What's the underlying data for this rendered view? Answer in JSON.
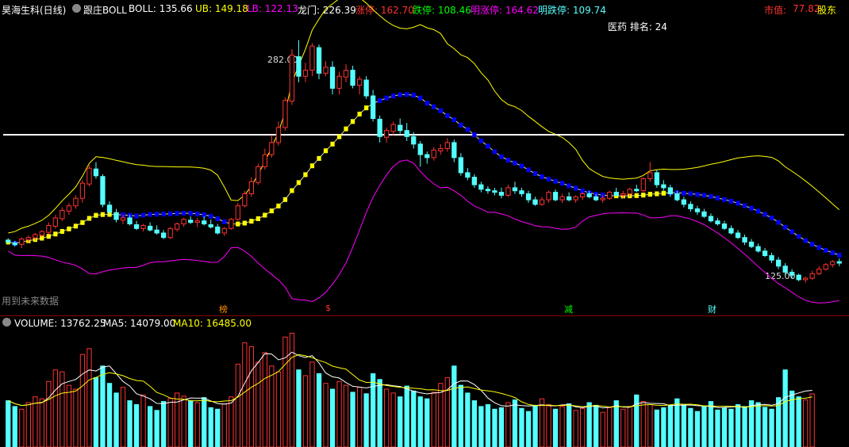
{
  "header": {
    "title": "昊海生科(日线)",
    "indicator": "跟庄BOLL",
    "boll": "BOLL: 135.66",
    "ub": "UB: 149.18",
    "lb": "LB: 122.13",
    "longmen": "龙门: 226.39",
    "zt": "涨停: 162.70",
    "dt": "跌停: 108.46",
    "mzt": "明涨停: 164.62",
    "mdt": "明跌停: 109.74",
    "mktcap_label": "市值:",
    "mktcap_value": "77.82",
    "holders": "股东",
    "rank": "医药 排名: 24",
    "future_note": "用到未来数据",
    "high_label": "282.00",
    "low_label": "125.00"
  },
  "markers": [
    "榜",
    "$",
    "减",
    "财"
  ],
  "volume_header": {
    "volume": "VOLUME: 13762.25",
    "ma5": "MA5: 14079.00",
    "ma10": "MA10: 16485.00"
  },
  "colors": {
    "up": "#ff3232",
    "down": "#54ffff",
    "ub": "#ffff00",
    "lb": "#ff00ff",
    "mid": "#ffffff",
    "buy": "#ffff00",
    "sell": "#0000ff"
  },
  "chart_data": {
    "type": "candlestick",
    "price_range": [
      118,
      300
    ],
    "volume_range": [
      0,
      30000
    ],
    "candles": [
      [
        153.2,
        154.5,
        150.8,
        152
      ],
      [
        151.5,
        152.8,
        149,
        150.2
      ],
      [
        150.5,
        155,
        148,
        154
      ],
      [
        153.5,
        156.5,
        151.5,
        155
      ],
      [
        154.8,
        158,
        153,
        157
      ],
      [
        156.5,
        160,
        155.5,
        159
      ],
      [
        158.5,
        165,
        157,
        163
      ],
      [
        162.5,
        170,
        161,
        168
      ],
      [
        167.5,
        175,
        166,
        173
      ],
      [
        172.5,
        178,
        170,
        176
      ],
      [
        176,
        183,
        174,
        181
      ],
      [
        181,
        193,
        178,
        191
      ],
      [
        190.5,
        203,
        189,
        201
      ],
      [
        200.5,
        205,
        194,
        196
      ],
      [
        195.5,
        197,
        175,
        177
      ],
      [
        176.5,
        179,
        170,
        172
      ],
      [
        171.5,
        174,
        165,
        167
      ],
      [
        166.5,
        170,
        164,
        168
      ],
      [
        168,
        170,
        163,
        164
      ],
      [
        163.5,
        166,
        160,
        161
      ],
      [
        161,
        164,
        159,
        163
      ],
      [
        162.5,
        165,
        159,
        160
      ],
      [
        160,
        163,
        157,
        158
      ],
      [
        158,
        160,
        154,
        155
      ],
      [
        155,
        162,
        154,
        161
      ],
      [
        160.5,
        165,
        159,
        164
      ],
      [
        164,
        168,
        162,
        167
      ],
      [
        166.5,
        169,
        164,
        165
      ],
      [
        165,
        168,
        162,
        166
      ],
      [
        166,
        169,
        163,
        164
      ],
      [
        163.5,
        167,
        161,
        162
      ],
      [
        162,
        164,
        157,
        158
      ],
      [
        158,
        162,
        156,
        161
      ],
      [
        161,
        168,
        160,
        167
      ],
      [
        167,
        178,
        166,
        176
      ],
      [
        176,
        186,
        175,
        184
      ],
      [
        184,
        195,
        182,
        192
      ],
      [
        191.5,
        204,
        190,
        202
      ],
      [
        202,
        214,
        200,
        210
      ],
      [
        210,
        223,
        208,
        218
      ],
      [
        218,
        232,
        216,
        228
      ],
      [
        228,
        248,
        226,
        246
      ],
      [
        245.5,
        280,
        243,
        276
      ],
      [
        275,
        286,
        258,
        262
      ],
      [
        262,
        271,
        258,
        266
      ],
      [
        266,
        284,
        262,
        282
      ],
      [
        281,
        283,
        260,
        264
      ],
      [
        264,
        272,
        262,
        268
      ],
      [
        268,
        272,
        250,
        254
      ],
      [
        254,
        265,
        250,
        262
      ],
      [
        261.5,
        270,
        258,
        266
      ],
      [
        266,
        269,
        254,
        256
      ],
      [
        256,
        262,
        250,
        260
      ],
      [
        259.5,
        262,
        247,
        249
      ],
      [
        249,
        253,
        232,
        234
      ],
      [
        233.5,
        236,
        218,
        222
      ],
      [
        221.5,
        228,
        218,
        226
      ],
      [
        225.5,
        232,
        223,
        230
      ],
      [
        229.5,
        234,
        224,
        226
      ],
      [
        226,
        231,
        219,
        222
      ],
      [
        222,
        225,
        214,
        217
      ],
      [
        217,
        219,
        202,
        210
      ],
      [
        210,
        212,
        204,
        208
      ],
      [
        208,
        215,
        206,
        213
      ],
      [
        212.5,
        217,
        210,
        214
      ],
      [
        214,
        221,
        212,
        218
      ],
      [
        218,
        220,
        205,
        208
      ],
      [
        208,
        211,
        196,
        198
      ],
      [
        198,
        201,
        193,
        195
      ],
      [
        195,
        197,
        188,
        190
      ],
      [
        190,
        192,
        185,
        187
      ],
      [
        187,
        189,
        184,
        186
      ],
      [
        186,
        188,
        183,
        185
      ],
      [
        185,
        188,
        181,
        183
      ],
      [
        183,
        190,
        182,
        188
      ],
      [
        188,
        192,
        184,
        186
      ],
      [
        186,
        188,
        182,
        184
      ],
      [
        184,
        186,
        178,
        180
      ],
      [
        180,
        182,
        176,
        177
      ],
      [
        177,
        182,
        176,
        180
      ],
      [
        180,
        186,
        178,
        185
      ],
      [
        185,
        187,
        179,
        180
      ],
      [
        180,
        184,
        178,
        182
      ],
      [
        182,
        185,
        179,
        180
      ],
      [
        180,
        183,
        178,
        182
      ],
      [
        182,
        185,
        180,
        184
      ],
      [
        184,
        186,
        181,
        182
      ],
      [
        182,
        184,
        179,
        180
      ],
      [
        180,
        183,
        178,
        181
      ],
      [
        181,
        186,
        180,
        185
      ],
      [
        185,
        188,
        182,
        183
      ],
      [
        183,
        186,
        181,
        184
      ],
      [
        184,
        188,
        182,
        187
      ],
      [
        187,
        190,
        185,
        186
      ],
      [
        186,
        195,
        185,
        194
      ],
      [
        194,
        205,
        192,
        198
      ],
      [
        198,
        200,
        188,
        190
      ],
      [
        190,
        193,
        186,
        188
      ],
      [
        188,
        190,
        182,
        184
      ],
      [
        184,
        186,
        179,
        180
      ],
      [
        180,
        182,
        175,
        177
      ],
      [
        177,
        179,
        172,
        174
      ],
      [
        174,
        176,
        170,
        172
      ],
      [
        172,
        174,
        168,
        169
      ],
      [
        169,
        171,
        165,
        166
      ],
      [
        166,
        168,
        163,
        164
      ],
      [
        164,
        166,
        160,
        161
      ],
      [
        161,
        163,
        157,
        158
      ],
      [
        158,
        160,
        154,
        155
      ],
      [
        155,
        157,
        150,
        152
      ],
      [
        152,
        154,
        148,
        149
      ],
      [
        149,
        151,
        145,
        146
      ],
      [
        146,
        148,
        142,
        143
      ],
      [
        143,
        145,
        138,
        140
      ],
      [
        140,
        142,
        134,
        136
      ],
      [
        136,
        138,
        130,
        132
      ],
      [
        132,
        134,
        128,
        130
      ],
      [
        130,
        131,
        126,
        127
      ],
      [
        127,
        129,
        125,
        128
      ],
      [
        128,
        133,
        127,
        131
      ],
      [
        131,
        136,
        130,
        134
      ],
      [
        134,
        138,
        133,
        137
      ],
      [
        137,
        140,
        135,
        139
      ],
      [
        139,
        141,
        136,
        138
      ]
    ],
    "volume": [
      12000,
      10500,
      9800,
      11500,
      13000,
      12500,
      17000,
      20000,
      19500,
      16000,
      15000,
      24000,
      25500,
      18000,
      21000,
      16500,
      14000,
      15500,
      12000,
      11000,
      13500,
      10500,
      9500,
      11800,
      12600,
      14000,
      13200,
      12000,
      11500,
      12800,
      10200,
      9800,
      11200,
      13000,
      21500,
      27000,
      26000,
      22000,
      24500,
      21000,
      19500,
      28500,
      29500,
      20000,
      18500,
      22000,
      19000,
      16500,
      15000,
      17000,
      16000,
      14200,
      15500,
      13800,
      19000,
      17500,
      15000,
      14000,
      13000,
      15800,
      14500,
      13000,
      12500,
      14200,
      16500,
      18000,
      21000,
      16000,
      14000,
      12000,
      10500,
      11000,
      9800,
      10200,
      11500,
      12200,
      10000,
      9200,
      10800,
      12500,
      11000,
      9800,
      10500,
      11200,
      9500,
      10000,
      11500,
      10800,
      9000,
      10200,
      12000,
      9800,
      10500,
      13500,
      11800,
      11000,
      9600,
      10200,
      10800,
      12500,
      11000,
      10000,
      9200,
      10500,
      11800,
      9600,
      10200,
      9800,
      11000,
      10500,
      12000,
      11500,
      10300,
      9800,
      12800,
      20000,
      14500,
      13000,
      12200,
      13762
    ]
  }
}
